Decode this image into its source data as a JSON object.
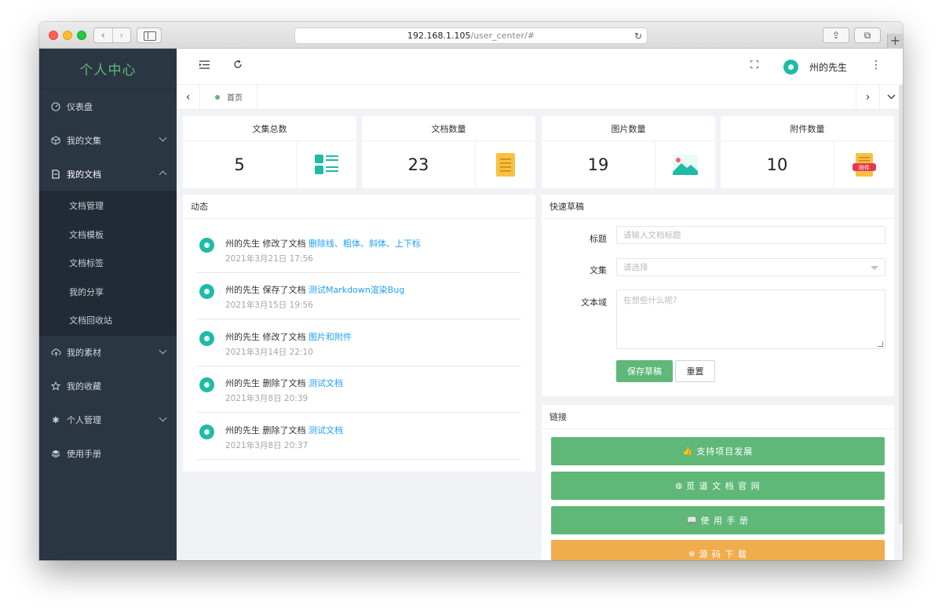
{
  "browser": {
    "url_host": "192.168.1.105",
    "url_path": "/user_center/#",
    "nav_back": "‹",
    "nav_forward": "›",
    "new_tab": "+"
  },
  "sidebar": {
    "brand": "个人中心",
    "items": [
      {
        "label": "仪表盘",
        "icon": "dashboard-icon"
      },
      {
        "label": "我的文集",
        "icon": "box-icon"
      },
      {
        "label": "我的文档",
        "icon": "document-icon"
      },
      {
        "label": "我的素材",
        "icon": "cloud-upload-icon"
      },
      {
        "label": "我的收藏",
        "icon": "star-icon"
      },
      {
        "label": "个人管理",
        "icon": "gear-icon"
      },
      {
        "label": "使用手册",
        "icon": "layers-icon"
      }
    ],
    "submenu": [
      "文档管理",
      "文档模板",
      "文档标签",
      "我的分享",
      "文档回收站"
    ]
  },
  "header": {
    "user_name": "州的先生"
  },
  "tabs": {
    "home": "首页"
  },
  "stats": [
    {
      "title": "文集总数",
      "value": "5",
      "icon": "list-icon",
      "color": "#1fbba6"
    },
    {
      "title": "文档数量",
      "value": "23",
      "icon": "document-icon",
      "color": "#f7c142"
    },
    {
      "title": "图片数量",
      "value": "19",
      "icon": "image-icon",
      "color": "#1fbba6"
    },
    {
      "title": "附件数量",
      "value": "10",
      "icon": "attachment-icon",
      "color": "#f7c142"
    }
  ],
  "attachment_badge": "附件",
  "activity": {
    "title": "动态",
    "items": [
      {
        "user": "州的先生",
        "action": "修改了文档",
        "doc": "删除线、粗体、斜体、上下标",
        "time": "2021年3月21日 17:56"
      },
      {
        "user": "州的先生",
        "action": "保存了文档",
        "doc": "测试Markdown渲染Bug",
        "time": "2021年3月15日 19:56"
      },
      {
        "user": "州的先生",
        "action": "修改了文档",
        "doc": "图片和附件",
        "time": "2021年3月14日 22:10"
      },
      {
        "user": "州的先生",
        "action": "删除了文档",
        "doc": "测试文档",
        "time": "2021年3月8日 20:39"
      },
      {
        "user": "州的先生",
        "action": "删除了文档",
        "doc": "测试文档",
        "time": "2021年3月8日 20:37"
      }
    ]
  },
  "draft": {
    "title": "快速草稿",
    "title_label": "标题",
    "title_placeholder": "请输入文档标题",
    "collection_label": "文集",
    "collection_placeholder": "请选择",
    "content_label": "文本域",
    "content_placeholder": "在想些什么呢?",
    "save_button": "保存草稿",
    "reset_button": "重置"
  },
  "links": {
    "title": "链接",
    "buttons": [
      {
        "label": "支持项目发展",
        "icon": "thumbs-up-icon"
      },
      {
        "label": "觅 道 文 档 官 网",
        "icon": "globe-icon"
      },
      {
        "label": "使 用 手 册",
        "icon": "book-icon"
      },
      {
        "label": "源 码 下 载",
        "icon": "download-icon"
      }
    ]
  },
  "colors": {
    "accent": "#5fb878",
    "link": "#1e9fff",
    "sidebar_bg": "#2b3643",
    "warning": "#f0ad4e"
  }
}
